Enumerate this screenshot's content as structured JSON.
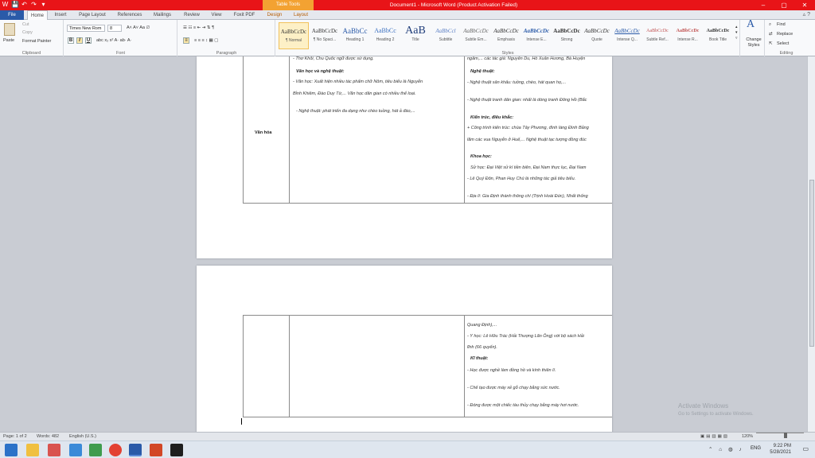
{
  "window": {
    "title": "Document1 - Microsoft Word (Product Activation Failed)",
    "table_tools_label": "Table Tools",
    "controls": [
      "–",
      "▢",
      "✕"
    ]
  },
  "quick_access": [
    "W",
    "💾",
    "↶",
    "↷",
    "▾"
  ],
  "ribbon_tabs": [
    "File",
    "Home",
    "Insert",
    "Page Layout",
    "References",
    "Mailings",
    "Review",
    "View",
    "Foxit PDF",
    "Design",
    "Layout"
  ],
  "clipboard": {
    "paste": "Paste",
    "cut": "Cut",
    "copy": "Copy",
    "format_painter": "Format Painter",
    "label": "Clipboard"
  },
  "font": {
    "name": "Times New Rom",
    "size": "8",
    "label": "Font"
  },
  "paragraph": {
    "label": "Paragraph"
  },
  "styles": {
    "label": "Styles",
    "items": [
      {
        "preview": "AaBbCcDc",
        "name": "¶ Normal"
      },
      {
        "preview": "AaBbCcDc",
        "name": "¶ No Spaci..."
      },
      {
        "preview": "AaBbCc",
        "name": "Heading 1"
      },
      {
        "preview": "AaBbCc",
        "name": "Heading 2"
      },
      {
        "preview": "AaB",
        "name": "Title"
      },
      {
        "preview": "AaBbCcl",
        "name": "Subtitle"
      },
      {
        "preview": "AaBbCcDc",
        "name": "Subtle Em..."
      },
      {
        "preview": "AaBbCcDc",
        "name": "Emphasis"
      },
      {
        "preview": "AaBbCcDc",
        "name": "Intense E..."
      },
      {
        "preview": "AaBbCcDc",
        "name": "Strong"
      },
      {
        "preview": "AaBbCcDc",
        "name": "Quote"
      },
      {
        "preview": "AaBbCcDc",
        "name": "Intense Q..."
      },
      {
        "preview": "AaBbCcDc",
        "name": "Subtle Ref..."
      },
      {
        "preview": "AaBbCcDc",
        "name": "Intense R..."
      },
      {
        "preview": "AaBbCcDc",
        "name": "Book Title"
      }
    ],
    "change_styles": "Change Styles"
  },
  "editing": {
    "find": "Find",
    "replace": "Replace",
    "select": "Select",
    "label": "Editing"
  },
  "document": {
    "page1": {
      "row_label": "Văn hóa",
      "col2": [
        {
          "text": "- Thơ Khôi, Chu Quốc ngữ được sử dụng.",
          "bold": false
        },
        {
          "text": "Văn học và nghệ thuật:",
          "bold": true
        },
        {
          "text": "- Văn học: Xuất hiện nhiều tác phẩm chữ Nôm, tiêu biểu là Nguyễn",
          "bold": false
        },
        {
          "text": "Bỉnh Khiêm, Đào Duy Từ,... Văn học dân gian có nhiều thể loại.",
          "bold": false
        },
        {
          "text": "- Nghệ thuật: phát triển đa dạng như chèo tuồng, hát ả đào,...",
          "bold": false
        }
      ],
      "col3": [
        {
          "text": "ngâm,... các tác giả: Nguyễn Du, Hồ Xuân Hương, Bà Huyện",
          "bold": false
        },
        {
          "text": "Nghệ thuật:",
          "bold": true
        },
        {
          "text": "- Nghệ thuật sân khấu: tuồng, chèo, hát quan họ,...",
          "bold": false
        },
        {
          "text": "- Nghệ thuật tranh dân gian: nhất là dòng tranh Đông Hồ (Bắc",
          "bold": false
        },
        {
          "text": "Kiến trúc, điêu khắc:",
          "bold": true
        },
        {
          "text": "+ Công trình kiến trúc: chùa Tây Phương, đình làng Đình Bảng",
          "bold": false
        },
        {
          "text": "lăm các vua Nguyễn ở Huế,... Nghệ thuật tạc tượng đồng đúc",
          "bold": false
        },
        {
          "text": "Khoa học:",
          "bold": true
        },
        {
          "text": "Sử học: Đại Việt sử kí tiền biên, Đại Nam thực lục, Đại Nam",
          "bold": false
        },
        {
          "text": "- Lê Quý Đôn, Phan Huy Chú là những tác giả tiêu biểu.",
          "bold": false
        },
        {
          "text": "- Địa lí: Gia Định thành thông chí (Trịnh Hoài Đức), Nhất thống",
          "bold": false
        }
      ]
    },
    "page2": {
      "col3": [
        {
          "text": "Quang Định),...",
          "bold": false
        },
        {
          "text": "- Y học: Lê Hữu Trác (Hải Thượng Lãn Ông) với bộ sách Hải",
          "bold": false
        },
        {
          "text": "lĩnh (66 quyển).",
          "bold": false
        },
        {
          "text": "Kĩ thuật:",
          "bold": true
        },
        {
          "text": "- Học được nghề làm đồng hồ và kính thiên lí.",
          "bold": false
        },
        {
          "text": "- Chế tạo được máy xẻ gỗ chạy bằng sức nước.",
          "bold": false
        },
        {
          "text": "- Đóng được một chiếc tàu thủy chạy bằng máy hơi nước.",
          "bold": false
        }
      ]
    }
  },
  "status": {
    "page": "Page: 1 of 2",
    "words": "Words: 482",
    "language": "English (U.S.)",
    "zoom": "120%"
  },
  "watermark": {
    "title": "Activate Windows",
    "subtitle": "Go to Settings to activate Windows."
  },
  "tray": {
    "language": "ENG",
    "time": "9:22 PM",
    "date": "5/28/2021"
  },
  "colors": {
    "title_bar": "#e81418",
    "table_tools": "#f3a232",
    "file_tab": "#2a5aa8"
  }
}
